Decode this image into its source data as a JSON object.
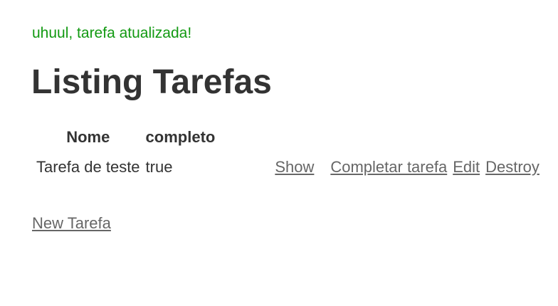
{
  "notice": "uhuul, tarefa atualizada!",
  "page_title": "Listing Tarefas",
  "table": {
    "headers": [
      "Nome",
      "completo"
    ],
    "rows": [
      {
        "nome": "Tarefa de teste",
        "completo": "true",
        "actions": {
          "show": "Show",
          "complete": "Completar tarefa",
          "edit": "Edit",
          "destroy": "Destroy"
        }
      }
    ]
  },
  "new_link": "New Tarefa",
  "colors": {
    "notice": "#119911",
    "text": "#333333",
    "link": "#666666"
  }
}
